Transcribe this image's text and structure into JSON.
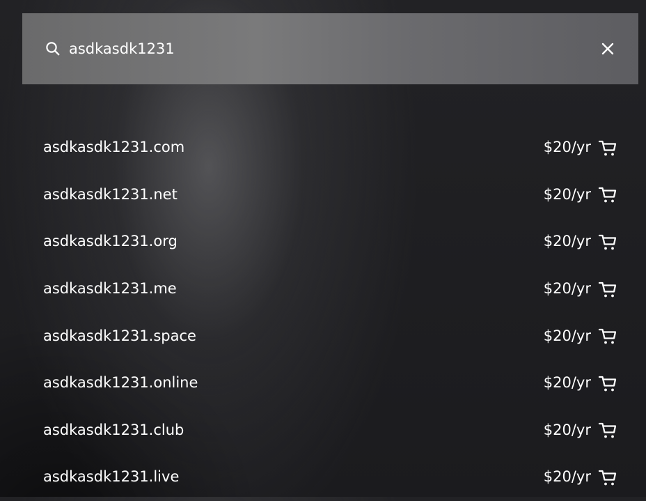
{
  "search": {
    "value": "asdkasdk1231",
    "icon": "search-icon",
    "clear_icon": "close-icon"
  },
  "results": [
    {
      "domain": "asdkasdk1231.com",
      "price": "$20/yr",
      "icon": "cart-icon"
    },
    {
      "domain": "asdkasdk1231.net",
      "price": "$20/yr",
      "icon": "cart-icon"
    },
    {
      "domain": "asdkasdk1231.org",
      "price": "$20/yr",
      "icon": "cart-icon"
    },
    {
      "domain": "asdkasdk1231.me",
      "price": "$20/yr",
      "icon": "cart-icon"
    },
    {
      "domain": "asdkasdk1231.space",
      "price": "$20/yr",
      "icon": "cart-icon"
    },
    {
      "domain": "asdkasdk1231.online",
      "price": "$20/yr",
      "icon": "cart-icon"
    },
    {
      "domain": "asdkasdk1231.club",
      "price": "$20/yr",
      "icon": "cart-icon"
    },
    {
      "domain": "asdkasdk1231.live",
      "price": "$20/yr",
      "icon": "cart-icon"
    }
  ],
  "colors": {
    "background": "#1c1c1f",
    "search_bar": "#747475",
    "text": "#ffffff"
  }
}
